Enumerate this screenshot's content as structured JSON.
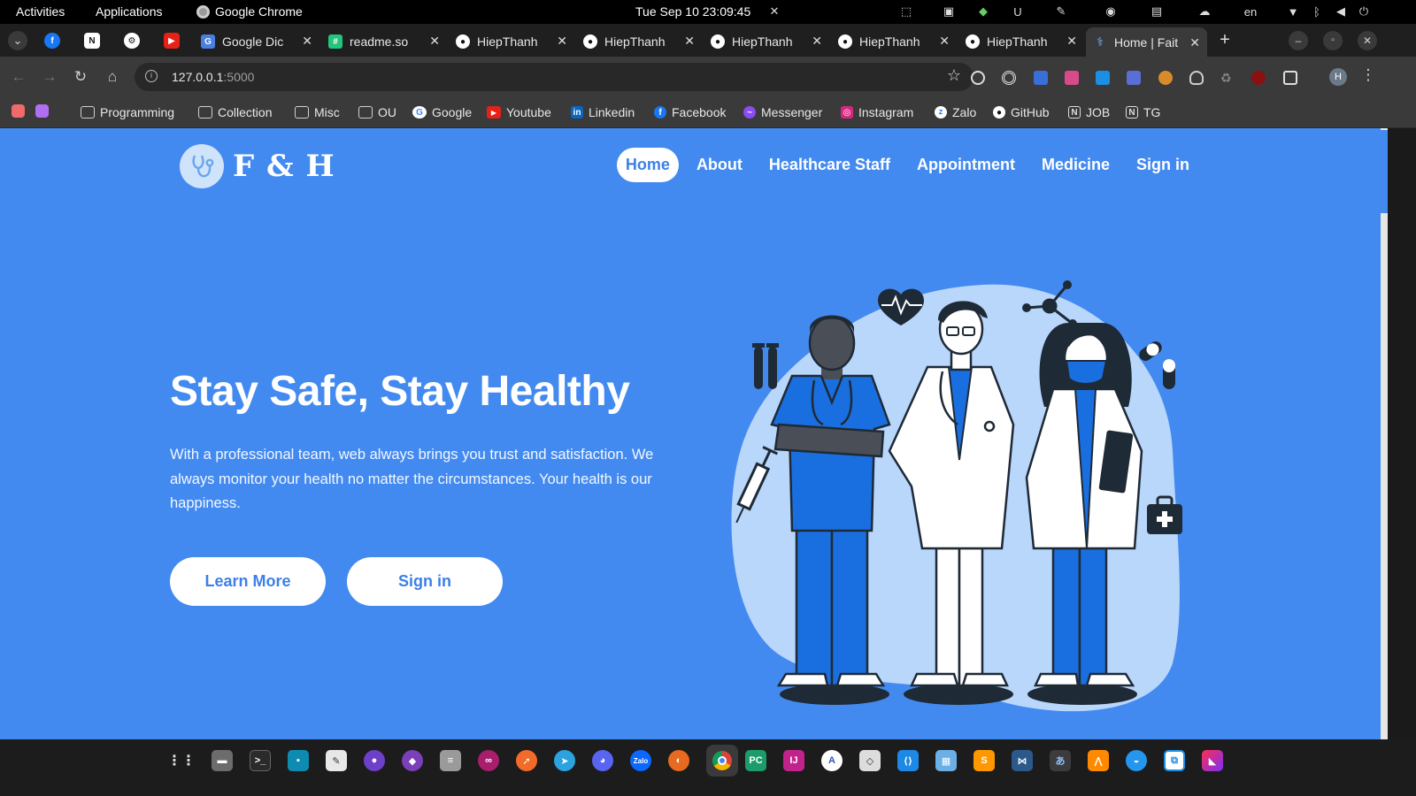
{
  "system_bar": {
    "activities": "Activities",
    "applications": "Applications",
    "app_name": "Google Chrome",
    "clock": "Tue Sep 10  23:09:45",
    "language": "en"
  },
  "tabs": [
    {
      "label": "Google Dic",
      "icon": "google-translate-icon"
    },
    {
      "label": "readme.so",
      "icon": "readme-icon"
    },
    {
      "label": "HiepThanh",
      "icon": "github-icon"
    },
    {
      "label": "HiepThanh",
      "icon": "github-icon"
    },
    {
      "label": "HiepThanh",
      "icon": "github-icon"
    },
    {
      "label": "HiepThanh",
      "icon": "github-icon"
    },
    {
      "label": "HiepThanh",
      "icon": "github-icon"
    },
    {
      "label": "Home | Fait",
      "icon": "stethoscope-icon",
      "active": true
    }
  ],
  "address_bar": {
    "host": "127.0.0.1",
    "port": ":5000"
  },
  "bookmarks": [
    {
      "label": "Programming",
      "icon": "folder-icon"
    },
    {
      "label": "Collection",
      "icon": "folder-icon"
    },
    {
      "label": "Misc",
      "icon": "folder-icon"
    },
    {
      "label": "OU",
      "icon": "folder-icon"
    },
    {
      "label": "Google",
      "icon": "google-icon"
    },
    {
      "label": "Youtube",
      "icon": "youtube-icon"
    },
    {
      "label": "Linkedin",
      "icon": "linkedin-icon"
    },
    {
      "label": "Facebook",
      "icon": "facebook-icon"
    },
    {
      "label": "Messenger",
      "icon": "messenger-icon"
    },
    {
      "label": "Instagram",
      "icon": "instagram-icon"
    },
    {
      "label": "Zalo",
      "icon": "zalo-icon"
    },
    {
      "label": "GitHub",
      "icon": "github-icon"
    },
    {
      "label": "JOB",
      "icon": "notion-icon"
    },
    {
      "label": "TG",
      "icon": "notion-icon"
    }
  ],
  "site": {
    "brand": "F & H",
    "nav": [
      {
        "label": "Home",
        "active": true
      },
      {
        "label": "About"
      },
      {
        "label": "Healthcare Staff"
      },
      {
        "label": "Appointment"
      },
      {
        "label": "Medicine"
      },
      {
        "label": "Sign in"
      }
    ],
    "hero_title": "Stay Safe, Stay Healthy",
    "hero_text": "With a professional team, web always brings you trust and satisfaction. We always monitor your health no matter the circumstances. Your health is our happiness.",
    "learn_more": "Learn More",
    "sign_in": "Sign in",
    "accent": "#438af0",
    "button_text_color": "#3c80e7"
  }
}
